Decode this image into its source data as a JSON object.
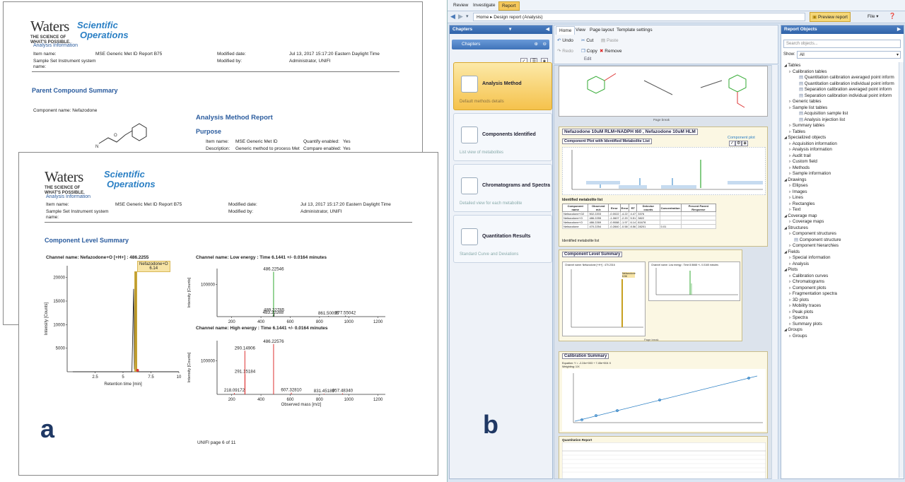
{
  "logo": {
    "waters": "Waters",
    "tagline1": "THE SCIENCE OF",
    "tagline2": "WHAT'S POSSIBLE.",
    "scientific": "Scientific",
    "operations": "Operations"
  },
  "report_back": {
    "analysis_info": "Analysis Information",
    "item_name_lbl": "Item name:",
    "item_name": "MSE Generic Met ID Report B75",
    "modified_date_lbl": "Modified date:",
    "modified_date": "Jul 13, 2017 15:17:20 Eastern Daylight Time",
    "instrument_lbl": "Sample Set Instrument system",
    "instrument_lbl2": "name:",
    "modified_by_lbl": "Modified by:",
    "modified_by": "Administrator, UNIFI",
    "parent_summary": "Parent Compound Summary",
    "component_name": "Component name: Nefazodone",
    "method_report": "Analysis Method Report",
    "purpose": "Purpose",
    "p_item_lbl": "Item name:",
    "p_item": "MSE Generic Met ID",
    "p_desc_lbl": "Description:",
    "p_desc": "Generic method to process Met",
    "quantify_lbl": "Quantify enabled:",
    "quantify": "Yes",
    "compare_lbl": "Compare enabled:",
    "compare": "Yes"
  },
  "report_front": {
    "analysis_info": "Analysis Information",
    "item_name_lbl": "Item name:",
    "item_name": "MSE Generic Met ID Report B75",
    "modified_date_lbl": "Modified date:",
    "modified_date": "Jul 13, 2017 15:17:20 Eastern Daylight Time",
    "instrument_lbl": "Sample Set Instrument system",
    "instrument_lbl2": "name:",
    "modified_by_lbl": "Modified by:",
    "modified_by": "Administrator, UNIFI",
    "component_summary": "Component Level Summary",
    "channel1": "Channel name: Nefazodone+O [+H+] : 486.2255",
    "peak_label": "Nefazodone+O",
    "peak_rt": "6.14",
    "channel_low": "Channel name: Low energy : Time 6.1441 +/- 0.0164 minutes",
    "channel_high": "Channel name: High energy : Time 6.1441 +/- 0.0164 minutes",
    "footer": "UNIFI page 6 of 11",
    "panel_letter": "a"
  },
  "app_letter": "b",
  "chart_data": [
    {
      "type": "line",
      "name": "chromatogram",
      "xlabel": "Retention time [min]",
      "ylabel": "Intensity [Counts]",
      "xticks": [
        "2.5",
        "5",
        "7.5",
        "10"
      ],
      "yticks": [
        "5000",
        "10000",
        "15000",
        "20000"
      ],
      "x": [
        0.5,
        5.8,
        5.95,
        6.02,
        6.08,
        6.14,
        6.2,
        6.3,
        10
      ],
      "y": [
        0,
        0,
        17600,
        500,
        3000,
        21300,
        600,
        0,
        0
      ],
      "xlim": [
        0,
        10
      ],
      "ylim": [
        0,
        22500
      ]
    },
    {
      "type": "bar",
      "name": "low-energy-spectrum",
      "xlabel": "",
      "ylabel": "Intensity [Counts]",
      "xticks": [
        "200",
        "400",
        "600",
        "800",
        "1000",
        "1200"
      ],
      "yticks": [
        "100000"
      ],
      "x": [
        483.20268,
        486.22546,
        489.22785,
        861.50095,
        977.55042
      ],
      "y": [
        4000,
        140000,
        12000,
        2000,
        3000
      ],
      "labels": [
        "483.20268",
        "486.22546",
        "489.22785",
        "861.50095",
        "977.55042"
      ],
      "xlim": [
        100,
        1250
      ],
      "ylim": [
        0,
        150000
      ]
    },
    {
      "type": "bar",
      "name": "high-energy-spectrum",
      "xlabel": "Observed mass [m/z]",
      "ylabel": "Intensity [Counts]",
      "xticks": [
        "200",
        "400",
        "600",
        "800",
        "1000",
        "1200"
      ],
      "yticks": [
        "100000"
      ],
      "x": [
        218.09172,
        291.15184,
        290.14906,
        486.22576,
        607.3281,
        831.45189,
        957.4834
      ],
      "y": [
        4000,
        60000,
        130000,
        150000,
        5000,
        2000,
        3000
      ],
      "labels": [
        "218.09172",
        "291.15184",
        "290.14906",
        "486.22576",
        "607.32810",
        "831.45189",
        "957.48340"
      ],
      "xlim": [
        100,
        1250
      ],
      "ylim": [
        0,
        160000
      ]
    }
  ],
  "app": {
    "tabs": [
      "Review",
      "Investigate",
      "Report"
    ],
    "breadcrumb": "Home ▸ Design report (Analysis)",
    "preview_btn": "Preview report",
    "file_btn": "File ▾",
    "chapters_hdr": "Chapters",
    "chapters_sub": "Chapters",
    "ribbon_tabs": [
      "Home",
      "View",
      "Page layout",
      "Template settings"
    ],
    "undo": "Undo",
    "redo": "Redo",
    "cut": "Cut",
    "copy": "Copy",
    "paste": "Paste",
    "remove": "Remove",
    "edit": "Edit",
    "cards": [
      {
        "title": "Analysis Method",
        "desc": "Default methods details"
      },
      {
        "title": "Components Identified",
        "desc": "List view of metabolites"
      },
      {
        "title": "Chromatograms and Spectra",
        "desc": "Detailed view for each metabolite"
      },
      {
        "title": "Quantitation Results",
        "desc": "Standard Curve and Deviations"
      }
    ],
    "report_objects": "Report Objects",
    "search_placeholder": "Search objects...",
    "show_lbl": "Show:",
    "show_val": "All",
    "tree": [
      {
        "t": "Tables",
        "l": 0
      },
      {
        "t": "Calibration tables",
        "l": 1
      },
      {
        "t": "Quantitation calibration averaged point inform",
        "l": 3
      },
      {
        "t": "Quantitation calibration individual point inform",
        "l": 3
      },
      {
        "t": "Separation calibration averaged point inform",
        "l": 3
      },
      {
        "t": "Separation calibration individual point inform",
        "l": 3
      },
      {
        "t": "Generic tables",
        "l": 1
      },
      {
        "t": "Sample list tables",
        "l": 1
      },
      {
        "t": "Acquisition sample list",
        "l": 3
      },
      {
        "t": "Analysis injection list",
        "l": 3
      },
      {
        "t": "Summary tables",
        "l": 1
      },
      {
        "t": "Tables",
        "l": 1
      },
      {
        "t": "Specialized objects",
        "l": 0
      },
      {
        "t": "Acquisition information",
        "l": 1
      },
      {
        "t": "Analysis information",
        "l": 1
      },
      {
        "t": "Audit trail",
        "l": 1
      },
      {
        "t": "Custom field",
        "l": 1
      },
      {
        "t": "Methods",
        "l": 1
      },
      {
        "t": "Sample information",
        "l": 1
      },
      {
        "t": "Drawings",
        "l": 0
      },
      {
        "t": "Ellipses",
        "l": 1
      },
      {
        "t": "Images",
        "l": 1
      },
      {
        "t": "Lines",
        "l": 1
      },
      {
        "t": "Rectangles",
        "l": 1
      },
      {
        "t": "Text",
        "l": 1
      },
      {
        "t": "Coverage map",
        "l": 0
      },
      {
        "t": "Coverage maps",
        "l": 1
      },
      {
        "t": "Structures",
        "l": 0
      },
      {
        "t": "Component structures",
        "l": 1
      },
      {
        "t": "Component structure",
        "l": 2
      },
      {
        "t": "Component hierarchies",
        "l": 1
      },
      {
        "t": "Fields",
        "l": 0
      },
      {
        "t": "Special information",
        "l": 1
      },
      {
        "t": "Analysis",
        "l": 1
      },
      {
        "t": "Plots",
        "l": 0
      },
      {
        "t": "Calibration curves",
        "l": 1
      },
      {
        "t": "Chromatograms",
        "l": 1
      },
      {
        "t": "Component plots",
        "l": 1
      },
      {
        "t": "Fragmentation spectra",
        "l": 1
      },
      {
        "t": "3D plots",
        "l": 1
      },
      {
        "t": "Mobility traces",
        "l": 1
      },
      {
        "t": "Peak plots",
        "l": 1
      },
      {
        "t": "Spectra",
        "l": 1
      },
      {
        "t": "Summary plots",
        "l": 1
      },
      {
        "t": "Groups",
        "l": 0
      },
      {
        "t": "Groups",
        "l": 1
      }
    ],
    "canvas": {
      "nef_title": "Nefazodone 10uM RLM+NADPH t60 , Nefazodone 10uM HLM",
      "plot_title": "Component Plot with Identified Metabolite List",
      "comp_plot": "Component plot",
      "id_list": "Identified metabolite list",
      "table_headers": [
        "Component name",
        "Observed m/z",
        "Error",
        "Error",
        "RT",
        "Detector counts",
        "Concentration",
        "Percent Parent Response"
      ],
      "table_rows": [
        [
          "Nefazodone+O2",
          "502.2203",
          "-0.0022",
          "-4.22",
          "4.47",
          "3376",
          ""
        ],
        [
          "Nefazodone+O",
          "486.2255",
          "-1.0607",
          "-2.20",
          "5.51",
          "3822",
          ""
        ],
        [
          "Nefazodone+O",
          "486.2269",
          "-0.9088",
          "-1.97",
          "6.14",
          "81678",
          ""
        ],
        [
          "Nefazodone",
          "470.2254",
          "-0.2840",
          "-0.58",
          "8.56",
          "28201",
          "0.01"
        ]
      ],
      "page_break": "Page break",
      "cls_title": "Component Level Summary",
      "cls_channel": "Channel name: Nefazodone [+H+] : 470.2316",
      "cls_low": "Channel name: Low energy : Time 8.5668 +/- 0.0165 minutes",
      "cls_peak": "Nefazodone 8.56",
      "cal_title": "Calibration Summary",
      "cal_eq": "Equation: Y = -2.24e+003 + 7.45e+004 X",
      "cal_wt": "Weighting: 1/X",
      "quant_title": "Quantitation Report"
    }
  }
}
